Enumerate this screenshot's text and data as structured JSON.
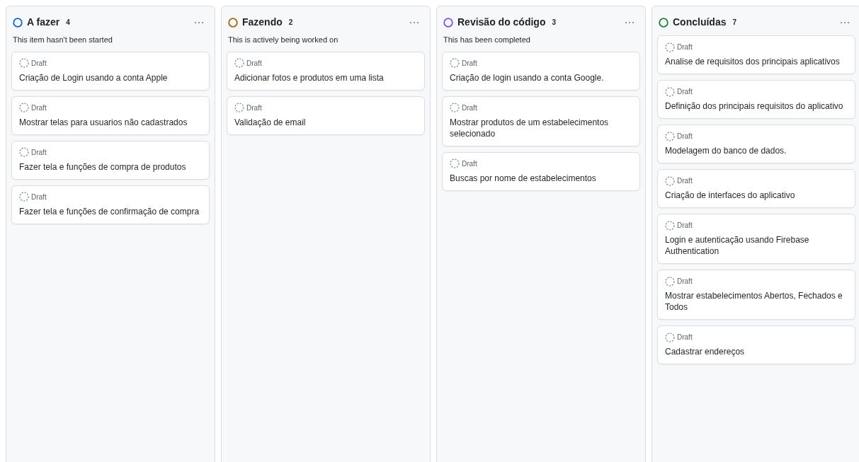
{
  "columns": [
    {
      "title": "A fazer",
      "count": "4",
      "color": "#0969da",
      "description": "This item hasn't been started",
      "cards": [
        {
          "status": "Draft",
          "title": "Criação de Login usando a conta Apple"
        },
        {
          "status": "Draft",
          "title": "Mostrar telas para usuarios não cadastrados"
        },
        {
          "status": "Draft",
          "title": "Fazer tela e funções de compra de produtos"
        },
        {
          "status": "Draft",
          "title": "Fazer tela e funções de confirmação de compra"
        }
      ]
    },
    {
      "title": "Fazendo",
      "count": "2",
      "color": "#9a6700",
      "description": "This is actively being worked on",
      "cards": [
        {
          "status": "Draft",
          "title": "Adicionar fotos e produtos em uma lista"
        },
        {
          "status": "Draft",
          "title": "Validação de email"
        }
      ]
    },
    {
      "title": "Revisão do código",
      "count": "3",
      "color": "#8250df",
      "description": "This has been completed",
      "cards": [
        {
          "status": "Draft",
          "title": "Criação de login usando a conta Google."
        },
        {
          "status": "Draft",
          "title": "Mostrar produtos de um estabelecimentos selecionado"
        },
        {
          "status": "Draft",
          "title": "Buscas por nome de estabelecimentos"
        }
      ]
    },
    {
      "title": "Concluídas",
      "count": "7",
      "color": "#1a7f37",
      "cards": [
        {
          "status": "Draft",
          "title": "Analise de requisitos dos principais aplicativos"
        },
        {
          "status": "Draft",
          "title": "Definição dos principais requisitos do aplicativo"
        },
        {
          "status": "Draft",
          "title": "Modelagem do banco de dados."
        },
        {
          "status": "Draft",
          "title": "Criação de interfaces do aplicativo"
        },
        {
          "status": "Draft",
          "title": "Login e autenticação usando Firebase Authentication"
        },
        {
          "status": "Draft",
          "title": "Mostrar estabelecimentos Abertos, Fechados e Todos"
        },
        {
          "status": "Draft",
          "title": "Cadastrar endereços"
        }
      ]
    }
  ]
}
